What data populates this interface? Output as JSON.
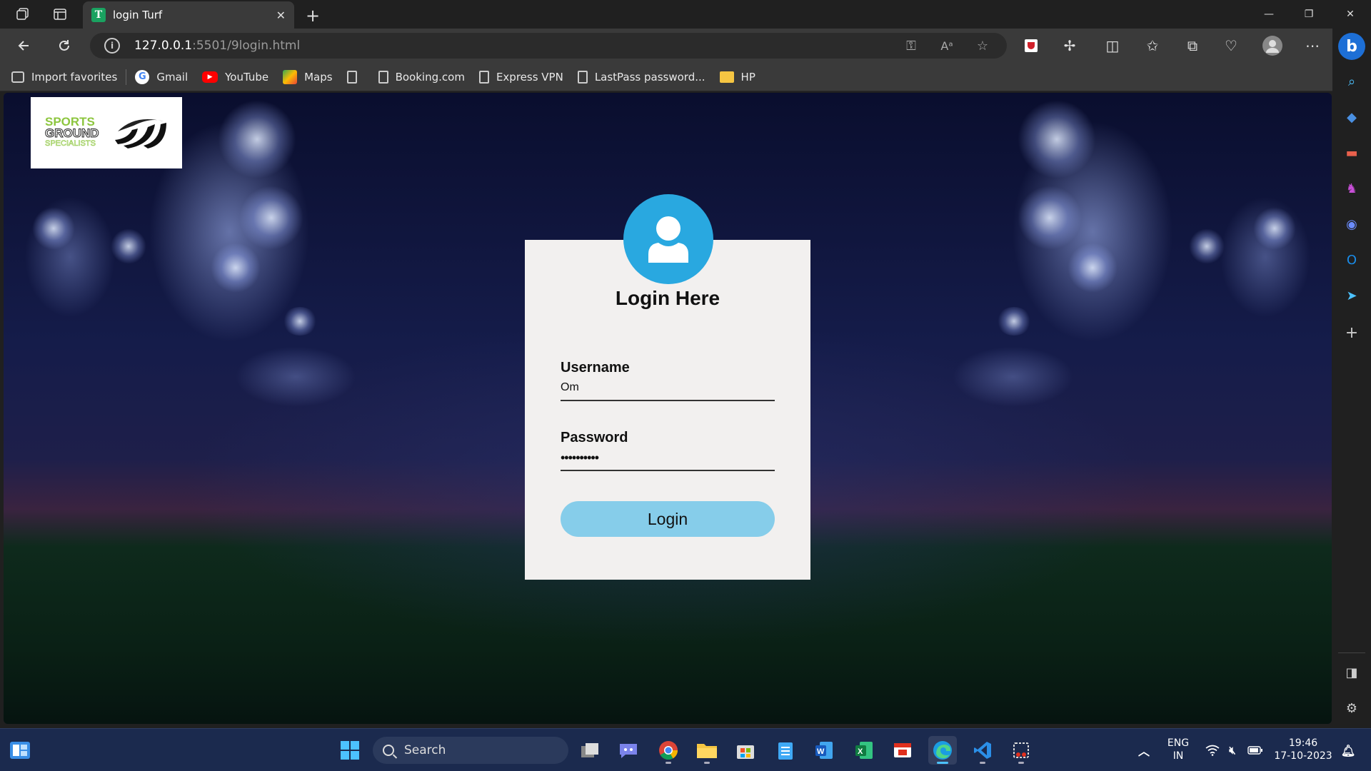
{
  "browser": {
    "tab_title": "login Turf",
    "tab_favicon": "T",
    "url_host": "127.0.0.1",
    "url_path": ":5501/9login.html"
  },
  "favorites": [
    {
      "label": "Import favorites",
      "icon": "import-icon"
    },
    {
      "label": "Gmail",
      "icon": "google-icon"
    },
    {
      "label": "YouTube",
      "icon": "youtube-icon"
    },
    {
      "label": "Maps",
      "icon": "maps-icon"
    },
    {
      "label": "",
      "icon": "document-icon"
    },
    {
      "label": "Booking.com",
      "icon": "document-icon"
    },
    {
      "label": "Express VPN",
      "icon": "document-icon"
    },
    {
      "label": "LastPass password...",
      "icon": "document-icon"
    },
    {
      "label": "HP",
      "icon": "folder-icon"
    }
  ],
  "page": {
    "logo_text_top": "SPORTS",
    "logo_text_mid": "GROUND",
    "logo_text_bottom": "SPECIALISTS",
    "title": "Login Here",
    "username_label": "Username",
    "username_value": "Om",
    "password_label": "Password",
    "password_value": "••••••••••",
    "login_button": "Login"
  },
  "taskbar": {
    "search_label": "Search",
    "language_top": "ENG",
    "language_bottom": "IN",
    "time": "19:46",
    "date": "17-10-2023"
  },
  "colors": {
    "avatar_blue": "#29a8e0",
    "login_button": "#86cdea",
    "card_bg": "#f2f0ef"
  }
}
